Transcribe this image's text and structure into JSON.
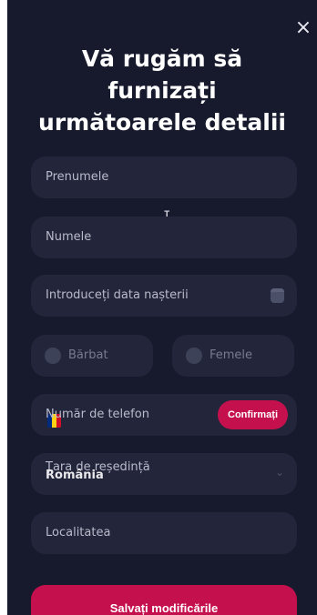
{
  "dialog": {
    "close_symbol": "×",
    "title": "Vă rugăm să furnizați următoarele detalii"
  },
  "form": {
    "first_name_placeholder": "Prenumele",
    "last_name_placeholder": "Numele",
    "birthdate_placeholder": "Introduceți data nașterii",
    "gender_male": "Bărbat",
    "gender_female": "Femele",
    "phone_placeholder": "Număr de telefon",
    "phone_flag_colors": [
      "#002b7f",
      "#fcd116",
      "#ce1126"
    ],
    "confirm_label": "Confirmați",
    "country_label": "Țara de reședință",
    "country_value": "România",
    "city_placeholder": "Localitatea",
    "save_label": "Salvați modificările"
  },
  "colors": {
    "background": "#171a2c",
    "field": "#23263b",
    "accent": "#c5104e"
  }
}
